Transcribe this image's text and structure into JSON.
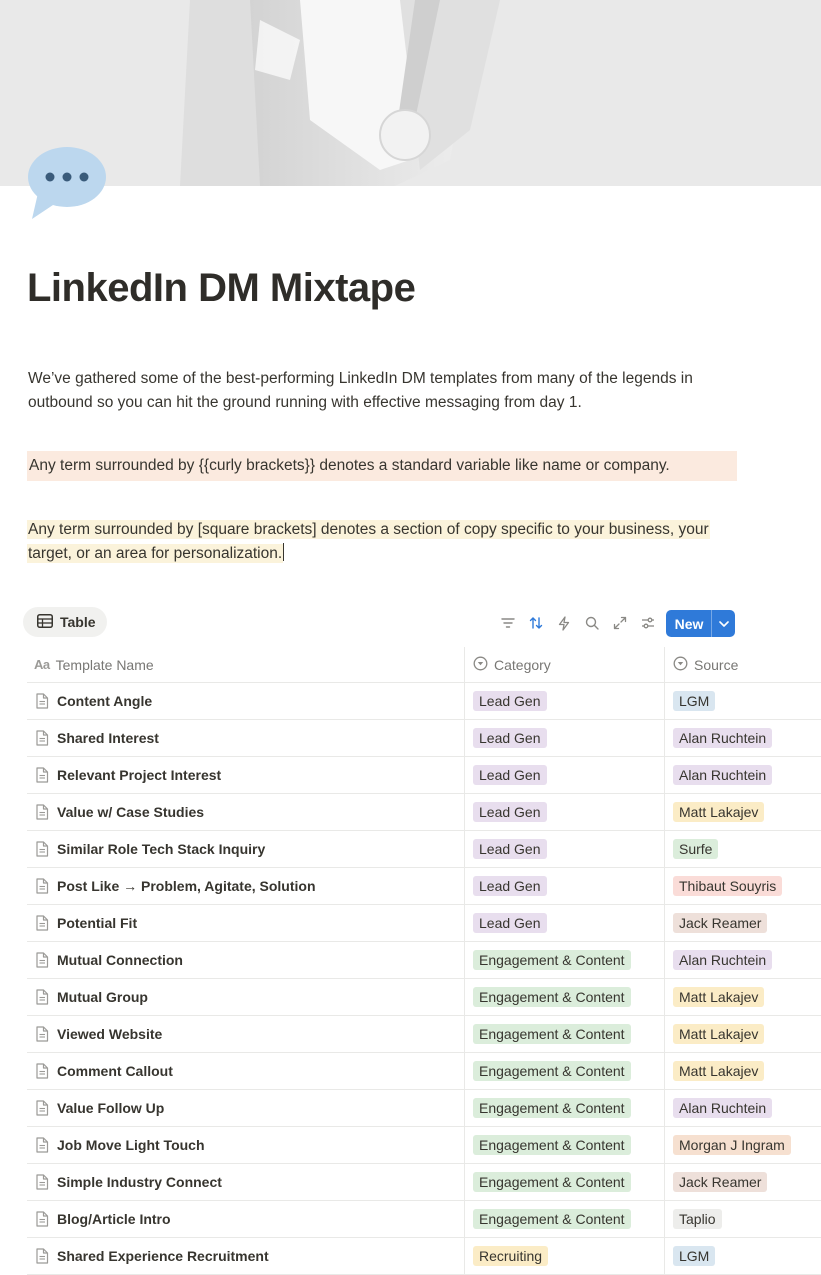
{
  "page": {
    "title": "LinkedIn DM Mixtape",
    "icon": "speech-bubble-icon",
    "intro": "We’ve gathered some of the best-performing LinkedIn DM templates from many of the legends in outbound so you can hit the ground running with effective messaging from day 1.",
    "callout_curly": "Any term surrounded by {{curly brackets}} denotes a standard variable like name or company.",
    "callout_square": "Any term surrounded by [square brackets] denotes a section of copy specific to your business, your target, or an area for personalization."
  },
  "view": {
    "tab_label": "Table",
    "toolbar_icons": [
      "filter-icon",
      "sort-icon",
      "automation-icon",
      "search-icon",
      "expand-icon",
      "settings-icon"
    ],
    "new_button_label": "New"
  },
  "table": {
    "columns": {
      "name": "Template Name",
      "category": "Category",
      "source": "Source"
    },
    "rows": [
      {
        "name": "Content Angle",
        "category": "Lead Gen",
        "source": "LGM"
      },
      {
        "name": "Shared Interest",
        "category": "Lead Gen",
        "source": "Alan Ruchtein"
      },
      {
        "name": "Relevant Project Interest",
        "category": "Lead Gen",
        "source": "Alan Ruchtein"
      },
      {
        "name": "Value w/ Case Studies",
        "category": "Lead Gen",
        "source": "Matt Lakajev"
      },
      {
        "name": "Similar Role Tech Stack Inquiry",
        "category": "Lead Gen",
        "source": "Surfe"
      },
      {
        "name": "Post Like → Problem, Agitate, Solution",
        "category": "Lead Gen",
        "source": "Thibaut Souyris"
      },
      {
        "name": "Potential Fit",
        "category": "Lead Gen",
        "source": "Jack Reamer"
      },
      {
        "name": "Mutual Connection",
        "category": "Engagement & Content",
        "source": "Alan Ruchtein"
      },
      {
        "name": "Mutual Group",
        "category": "Engagement & Content",
        "source": "Matt Lakajev"
      },
      {
        "name": "Viewed Website",
        "category": "Engagement & Content",
        "source": "Matt Lakajev"
      },
      {
        "name": "Comment Callout",
        "category": "Engagement & Content",
        "source": "Matt Lakajev"
      },
      {
        "name": "Value Follow Up",
        "category": "Engagement & Content",
        "source": "Alan Ruchtein"
      },
      {
        "name": "Job Move Light Touch",
        "category": "Engagement & Content",
        "source": "Morgan J Ingram"
      },
      {
        "name": "Simple Industry Connect",
        "category": "Engagement & Content",
        "source": "Jack Reamer"
      },
      {
        "name": "Blog/Article Intro",
        "category": "Engagement & Content",
        "source": "Taplio"
      },
      {
        "name": "Shared Experience Recruitment",
        "category": "Recruiting",
        "source": "LGM"
      }
    ]
  },
  "tag_colors": {
    "Lead Gen": "#e8deee",
    "Engagement & Content": "#dbeddb",
    "Recruiting": "#fbecc6",
    "LGM": "#d9e6f0",
    "Alan Ruchtein": "#e8deee",
    "Matt Lakajev": "#fbecc6",
    "Surfe": "#dbeddb",
    "Thibaut Souyris": "#fadcd8",
    "Jack Reamer": "#eee0da",
    "Morgan J Ingram": "#f6e0d0",
    "Taplio": "#ededeb"
  },
  "colors": {
    "accent": "#2f7ad9",
    "text": "#37352f",
    "muted": "#787774"
  }
}
